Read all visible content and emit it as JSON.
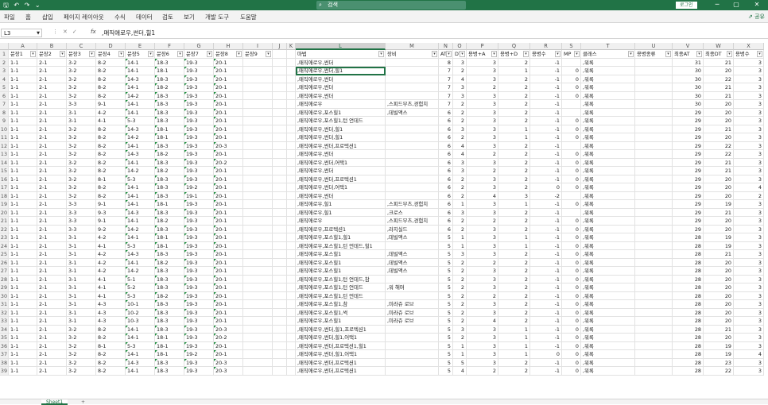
{
  "title": {
    "file": "왕그린사2 캐릭터메이킹.xlsx - Excel",
    "search": "검색",
    "login": "로그인",
    "min": "─",
    "restore": "▢",
    "close": "✕"
  },
  "ribbon": {
    "tabs": [
      "파일",
      "홈",
      "삽입",
      "페이지 레이아웃",
      "수식",
      "데이터",
      "검토",
      "보기",
      "개발 도구",
      "도움말"
    ],
    "share": "공유"
  },
  "formula": {
    "namebox": "L3",
    "fx": "fx",
    "value": ",매직애로우,썬더,힐1"
  },
  "columns": {
    "letters": [
      "A",
      "B",
      "C",
      "D",
      "E",
      "F",
      "G",
      "H",
      "I",
      "J",
      "K",
      "L",
      "M",
      "N",
      "O",
      "P",
      "Q",
      "R",
      "S",
      "T",
      "U",
      "V",
      "W",
      "X"
    ],
    "headers": [
      "문장1",
      "문장2",
      "문장3",
      "문장4",
      "문장5",
      "문장6",
      "문장7",
      "문장8",
      "문장9",
      "",
      "",
      "마법",
      "장비",
      "AT",
      "DT",
      "용병+A",
      "용병+D",
      "용병수",
      "MP",
      "클래스",
      "용병종류",
      "최종AT",
      "최종DT",
      "용병수"
    ]
  },
  "rows": [
    [
      "1-1",
      "2-1",
      "3-2",
      "8-2",
      "14-1",
      "18-3",
      "19-3",
      "20-1",
      ",매직애로우,썬더",
      "",
      "8",
      "3",
      "3",
      "2",
      "-1",
      "",
      ",워록",
      "",
      "31",
      "21",
      "3"
    ],
    [
      "1-1",
      "2-1",
      "3-2",
      "8-2",
      "14-1",
      "18-1",
      "19-3",
      "20-1",
      ",매직애로우,썬더,힐1",
      "",
      "7",
      "2",
      "3",
      "1",
      "-1",
      "0",
      ",워록",
      "",
      "30",
      "20",
      "3"
    ],
    [
      "1-1",
      "2-1",
      "3-2",
      "8-2",
      "14-3",
      "18-3",
      "19-3",
      "20-1",
      ",매직애로우,썬더",
      "",
      "7",
      "4",
      "3",
      "2",
      "-1",
      "0",
      ",워록",
      "",
      "30",
      "22",
      "3"
    ],
    [
      "1-1",
      "2-1",
      "3-2",
      "8-2",
      "14-1",
      "18-2",
      "19-3",
      "20-1",
      ",매직애로우,썬더",
      "",
      "7",
      "3",
      "2",
      "2",
      "-1",
      "0",
      ",워록",
      "",
      "30",
      "21",
      "3"
    ],
    [
      "1-1",
      "2-1",
      "3-2",
      "8-2",
      "14-2",
      "18-3",
      "19-3",
      "20-1",
      ",매직애로우,썬더",
      "",
      "7",
      "3",
      "3",
      "2",
      "-1",
      "0",
      ",워록",
      "",
      "30",
      "21",
      "3"
    ],
    [
      "1-1",
      "2-1",
      "3-3",
      "9-1",
      "14-1",
      "18-3",
      "19-3",
      "20-1",
      ",매직애로우",
      ",스피드부츠,경험치",
      "7",
      "2",
      "3",
      "2",
      "-1",
      "",
      ",워록",
      "",
      "30",
      "20",
      "3"
    ],
    [
      "1-1",
      "2-1",
      "3-1",
      "4-2",
      "14-1",
      "18-3",
      "19-3",
      "20-1",
      ",매직애로우,포스힐1",
      ",데빌액스",
      "6",
      "2",
      "3",
      "2",
      "-1",
      "",
      ",워록",
      "",
      "29",
      "20",
      "3"
    ],
    [
      "1-1",
      "2-1",
      "3-1",
      "4-1",
      "5-3",
      "18-3",
      "19-3",
      "20-1",
      ",매직애로우,포스힐1,턴 언데드",
      "",
      "6",
      "2",
      "3",
      "2",
      "-1",
      "0",
      ",워록",
      "",
      "29",
      "20",
      "3"
    ],
    [
      "1-1",
      "2-1",
      "3-2",
      "8-2",
      "14-3",
      "18-1",
      "19-3",
      "20-1",
      ",매직애로우,썬더,힐1",
      "",
      "6",
      "3",
      "3",
      "1",
      "-1",
      "0",
      ",워록",
      "",
      "29",
      "21",
      "3"
    ],
    [
      "1-1",
      "2-1",
      "3-2",
      "8-2",
      "14-2",
      "18-1",
      "19-3",
      "20-1",
      ",매직애로우,썬더,힐1",
      "",
      "6",
      "2",
      "3",
      "1",
      "-1",
      "0",
      ",워록",
      "",
      "29",
      "20",
      "3"
    ],
    [
      "1-1",
      "2-1",
      "3-2",
      "8-2",
      "14-1",
      "18-3",
      "19-3",
      "20-3",
      ",매직애로우,썬더,프로텍션1",
      "",
      "6",
      "4",
      "3",
      "2",
      "-1",
      "",
      ",워록",
      "",
      "29",
      "22",
      "3"
    ],
    [
      "1-1",
      "2-1",
      "3-2",
      "8-2",
      "14-3",
      "18-2",
      "19-3",
      "20-1",
      ",매직애로우,썬더",
      "",
      "6",
      "4",
      "2",
      "2",
      "-1",
      "0",
      ",워록",
      "",
      "29",
      "22",
      "3"
    ],
    [
      "1-1",
      "2-1",
      "3-2",
      "8-2",
      "14-1",
      "18-3",
      "19-3",
      "20-2",
      ",매직애로우,썬더,어택1",
      "",
      "6",
      "3",
      "3",
      "2",
      "-1",
      "0",
      ",워록",
      "",
      "29",
      "21",
      "3"
    ],
    [
      "1-1",
      "2-1",
      "3-2",
      "8-2",
      "14-2",
      "18-2",
      "19-3",
      "20-1",
      ",매직애로우,썬더",
      "",
      "6",
      "3",
      "2",
      "2",
      "-1",
      "0",
      ",워록",
      "",
      "29",
      "21",
      "3"
    ],
    [
      "1-1",
      "2-1",
      "3-2",
      "8-1",
      "5-3",
      "18-3",
      "19-3",
      "20-1",
      ",매직애로우,썬더,프로텍션1",
      "",
      "6",
      "2",
      "3",
      "2",
      "-1",
      "0",
      ",워록",
      "",
      "29",
      "20",
      "3"
    ],
    [
      "1-1",
      "2-1",
      "3-2",
      "8-2",
      "14-1",
      "18-3",
      "19-2",
      "20-1",
      ",매직애로우,썬더,어택1",
      "",
      "6",
      "2",
      "3",
      "2",
      "0",
      "0",
      ",워록",
      "",
      "29",
      "20",
      "4"
    ],
    [
      "1-1",
      "2-1",
      "3-2",
      "8-2",
      "14-1",
      "18-3",
      "19-1",
      "20-1",
      ",매직애로우,썬더",
      "",
      "6",
      "2",
      "4",
      "3",
      "-2",
      "",
      ",워록",
      "",
      "29",
      "20",
      "2"
    ],
    [
      "1-1",
      "2-1",
      "3-3",
      "9-1",
      "14-1",
      "18-1",
      "19-3",
      "20-1",
      ",매직애로우,힐1",
      ",스피드부츠,경험치",
      "6",
      "1",
      "3",
      "1",
      "-1",
      "0",
      ",워록",
      "",
      "29",
      "19",
      "3"
    ],
    [
      "1-1",
      "2-1",
      "3-3",
      "9-3",
      "14-3",
      "18-3",
      "19-3",
      "20-1",
      ",매직애로우,힐1",
      ",크로스",
      "6",
      "3",
      "3",
      "2",
      "-1",
      "",
      ",워록",
      "",
      "29",
      "21",
      "3"
    ],
    [
      "1-1",
      "2-1",
      "3-3",
      "9-1",
      "14-1",
      "18-2",
      "19-3",
      "20-1",
      ",매직애로우",
      ",스피드부츠,경험치",
      "6",
      "2",
      "2",
      "2",
      "-1",
      "0",
      ",워록",
      "",
      "29",
      "20",
      "3"
    ],
    [
      "1-1",
      "2-1",
      "3-3",
      "9-2",
      "14-2",
      "18-3",
      "19-3",
      "20-1",
      ",매직애로우,프로텍션1",
      ",라지실드",
      "6",
      "2",
      "3",
      "2",
      "-1",
      "0",
      ",워록",
      "",
      "29",
      "20",
      "3"
    ],
    [
      "1-1",
      "2-1",
      "3-1",
      "4-2",
      "14-1",
      "18-1",
      "19-3",
      "20-1",
      ",매직애로우,포스힐1,힐1",
      ",데빌액스",
      "5",
      "1",
      "3",
      "1",
      "-1",
      "0",
      ",워록",
      "",
      "28",
      "19",
      "3"
    ],
    [
      "1-1",
      "2-1",
      "3-1",
      "4-1",
      "5-3",
      "18-1",
      "19-3",
      "20-1",
      ",매직애로우,포스힐1,턴 언데드,힐1",
      "",
      "5",
      "1",
      "3",
      "1",
      "-1",
      "0",
      ",워록",
      "",
      "28",
      "19",
      "3"
    ],
    [
      "1-1",
      "2-1",
      "3-1",
      "4-2",
      "14-3",
      "18-3",
      "19-3",
      "20-1",
      ",매직애로우,포스힐1",
      ",데빌액스",
      "5",
      "3",
      "3",
      "2",
      "-1",
      "0",
      ",워록",
      "",
      "28",
      "21",
      "3"
    ],
    [
      "1-1",
      "2-1",
      "3-1",
      "4-2",
      "14-1",
      "18-2",
      "19-3",
      "20-1",
      ",매직애로우,포스힐1",
      ",데빌액스",
      "5",
      "2",
      "2",
      "2",
      "-1",
      "0",
      ",워록",
      "",
      "28",
      "20",
      "3"
    ],
    [
      "1-1",
      "2-1",
      "3-1",
      "4-2",
      "14-2",
      "18-3",
      "19-3",
      "20-1",
      ",매직애로우,포스힐1",
      ",데빌액스",
      "5",
      "2",
      "3",
      "2",
      "-1",
      "0",
      ",워록",
      "",
      "28",
      "20",
      "3"
    ],
    [
      "1-1",
      "2-1",
      "3-1",
      "4-1",
      "5-1",
      "18-3",
      "19-3",
      "20-1",
      ",매직애로우,포스힐1,턴 언데드,참",
      "",
      "5",
      "2",
      "3",
      "2",
      "-1",
      "0",
      ",워록",
      "",
      "28",
      "20",
      "3"
    ],
    [
      "1-1",
      "2-1",
      "3-1",
      "4-1",
      "5-2",
      "18-3",
      "19-3",
      "20-1",
      ",매직애로우,포스힐1,턴 언데드",
      ",워 해머",
      "5",
      "2",
      "3",
      "2",
      "-1",
      "0",
      ",워록",
      "",
      "28",
      "20",
      "3"
    ],
    [
      "1-1",
      "2-1",
      "3-1",
      "4-1",
      "5-3",
      "18-2",
      "19-3",
      "20-1",
      ",매직애로우,포스힐1,턴 언데드",
      "",
      "5",
      "2",
      "2",
      "2",
      "-1",
      "0",
      ",워록",
      "",
      "28",
      "20",
      "3"
    ],
    [
      "1-1",
      "2-1",
      "3-1",
      "4-3",
      "10-1",
      "18-3",
      "19-3",
      "20-1",
      ",매직애로우,포스힐1,참",
      ",미라쥬 로브",
      "5",
      "2",
      "3",
      "2",
      "-1",
      "0",
      ",워록",
      "",
      "28",
      "20",
      "3"
    ],
    [
      "1-1",
      "2-1",
      "3-1",
      "4-3",
      "10-2",
      "18-3",
      "19-3",
      "20-1",
      ",매직애로우,포스힐1,썩",
      ",미라쥬 로브",
      "5",
      "2",
      "3",
      "2",
      "-1",
      "0",
      ",워록",
      "",
      "28",
      "20",
      "3"
    ],
    [
      "1-1",
      "2-1",
      "3-1",
      "4-3",
      "10-3",
      "18-3",
      "19-3",
      "20-1",
      ",매직애로우,포스힐1",
      ",미라쥬 로브",
      "5",
      "2",
      "4",
      "2",
      "-1",
      "0",
      ",워록",
      "",
      "28",
      "20",
      "3"
    ],
    [
      "1-1",
      "2-1",
      "3-2",
      "8-2",
      "14-1",
      "18-3",
      "19-3",
      "20-3",
      ",매직애로우,썬더,힐1,프로텍션1",
      "",
      "5",
      "3",
      "3",
      "1",
      "-1",
      "0",
      ",워록",
      "",
      "28",
      "21",
      "3"
    ],
    [
      "1-1",
      "2-1",
      "3-2",
      "8-2",
      "14-1",
      "18-1",
      "19-3",
      "20-2",
      ",매직애로우,썬더,힐1,어택1",
      "",
      "5",
      "2",
      "3",
      "1",
      "-1",
      "0",
      ",워록",
      "",
      "28",
      "20",
      "3"
    ],
    [
      "1-1",
      "2-1",
      "3-2",
      "8-1",
      "5-3",
      "18-1",
      "19-3",
      "20-1",
      ",매직애로우,썬더,프로텍션1,힐1",
      "",
      "5",
      "1",
      "3",
      "1",
      "-1",
      "0",
      ",워록",
      "",
      "28",
      "19",
      "3"
    ],
    [
      "1-1",
      "2-1",
      "3-2",
      "8-2",
      "14-1",
      "18-1",
      "19-2",
      "20-1",
      ",매직애로우,썬더,힐1,어택1",
      "",
      "5",
      "1",
      "3",
      "1",
      "0",
      "0",
      ",워록",
      "",
      "28",
      "19",
      "4"
    ],
    [
      "1-1",
      "2-1",
      "3-2",
      "8-2",
      "14-3",
      "18-3",
      "19-3",
      "20-3",
      ",매직애로우,썬더,프로텍션1",
      "",
      "5",
      "5",
      "3",
      "2",
      "-1",
      "0",
      ",워록",
      "",
      "28",
      "23",
      "3"
    ],
    [
      "1-1",
      "2-1",
      "3-2",
      "8-2",
      "14-1",
      "18-3",
      "19-3",
      "20-3",
      ",매직애로우,썬더,프로텍션1",
      "",
      "5",
      "4",
      "2",
      "2",
      "-1",
      "0",
      ",워록",
      "",
      "28",
      "22",
      "3"
    ]
  ],
  "sheet": {
    "tab": "Sheet1",
    "add": "+"
  }
}
